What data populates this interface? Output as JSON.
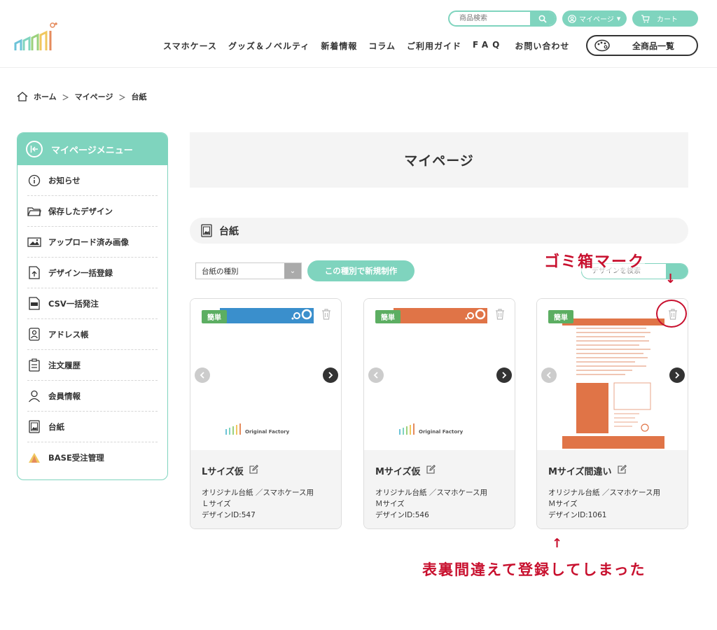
{
  "colors": {
    "accent": "#7fd4be",
    "badge": "#5cae62",
    "annotation": "#c8102e",
    "orange": "#e07447",
    "blue": "#3a8fcc"
  },
  "header": {
    "search_placeholder": "商品検索",
    "mypage_label": "マイページ",
    "cart_label": "カート",
    "nav": [
      "スマホケース",
      "グッズ＆ノベルティ",
      "新着情報",
      "コラム",
      "ご利用ガイド",
      "FAQ",
      "お問い合わせ"
    ],
    "all_items_label": "全商品一覧"
  },
  "breadcrumb": [
    "ホーム",
    "マイページ",
    "台紙"
  ],
  "sidebar": {
    "title": "マイページメニュー",
    "items": [
      {
        "label": "お知らせ",
        "icon": "info-icon"
      },
      {
        "label": "保存したデザイン",
        "icon": "folder-icon"
      },
      {
        "label": "アップロード済み画像",
        "icon": "image-icon"
      },
      {
        "label": "デザイン一括登録",
        "icon": "upload-file-icon"
      },
      {
        "label": "CSV一括発注",
        "icon": "csv-icon"
      },
      {
        "label": "アドレス帳",
        "icon": "address-book-icon"
      },
      {
        "label": "注文履歴",
        "icon": "clipboard-icon"
      },
      {
        "label": "会員情報",
        "icon": "user-icon"
      },
      {
        "label": "台紙",
        "icon": "mount-icon"
      },
      {
        "label": "BASE受注管理",
        "icon": "base-icon"
      }
    ]
  },
  "main": {
    "title": "マイページ",
    "section_title": "台紙",
    "type_select_value": "台紙の種別",
    "new_button_label": "この種別で新規制作",
    "design_search_placeholder": "デザインを検索"
  },
  "cards": [
    {
      "badge": "簡単",
      "name": "Lサイズ仮",
      "line1": "オリジナル台紙 ／スマホケース用",
      "line2": "Ｌサイズ",
      "line3": "デザインID:547",
      "logo_text": "Original Factory"
    },
    {
      "badge": "簡単",
      "name": "Mサイズ仮",
      "line1": "オリジナル台紙 ／スマホケース用",
      "line2": "Ｍサイズ",
      "line3": "デザインID:546",
      "logo_text": "Original Factory"
    },
    {
      "badge": "簡単",
      "name": "Mサイズ間違い",
      "line1": "オリジナル台紙 ／スマホケース用",
      "line2": "Ｍサイズ",
      "line3": "デザインID:1061"
    }
  ],
  "annotations": {
    "trash_label": "ゴミ箱マーク",
    "mistake_label": "表裏間違えて登録してしまった"
  }
}
